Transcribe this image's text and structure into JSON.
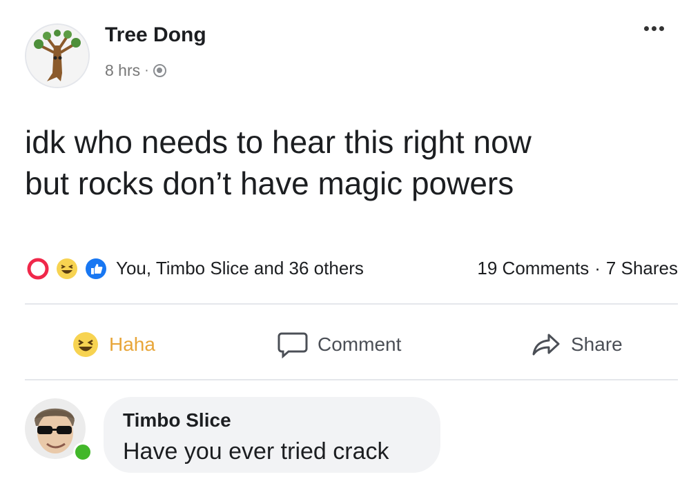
{
  "post": {
    "author_name": "Tree Dong",
    "time": "8 hrs",
    "separator": "·",
    "text_lines": [
      "idk who needs to hear this right now",
      "but rocks don’t have magic powers"
    ]
  },
  "reactions": {
    "icons": [
      "love-icon",
      "haha-icon",
      "like-icon"
    ],
    "reactors": "You, Timbo Slice and 36 others",
    "comments": "19 Comments",
    "dot": "·",
    "shares": "7 Shares"
  },
  "actions": {
    "haha_label": "Haha",
    "comment_label": "Comment",
    "share_label": "Share"
  },
  "comment": {
    "author_name": "Timbo Slice",
    "text": "Have you ever tried crack",
    "online": true
  },
  "colors": {
    "haha_accent": "#e8a63a",
    "love": "#f0284a",
    "like": "#1877f2",
    "online": "#42b72a",
    "bubble": "#f2f3f5"
  }
}
